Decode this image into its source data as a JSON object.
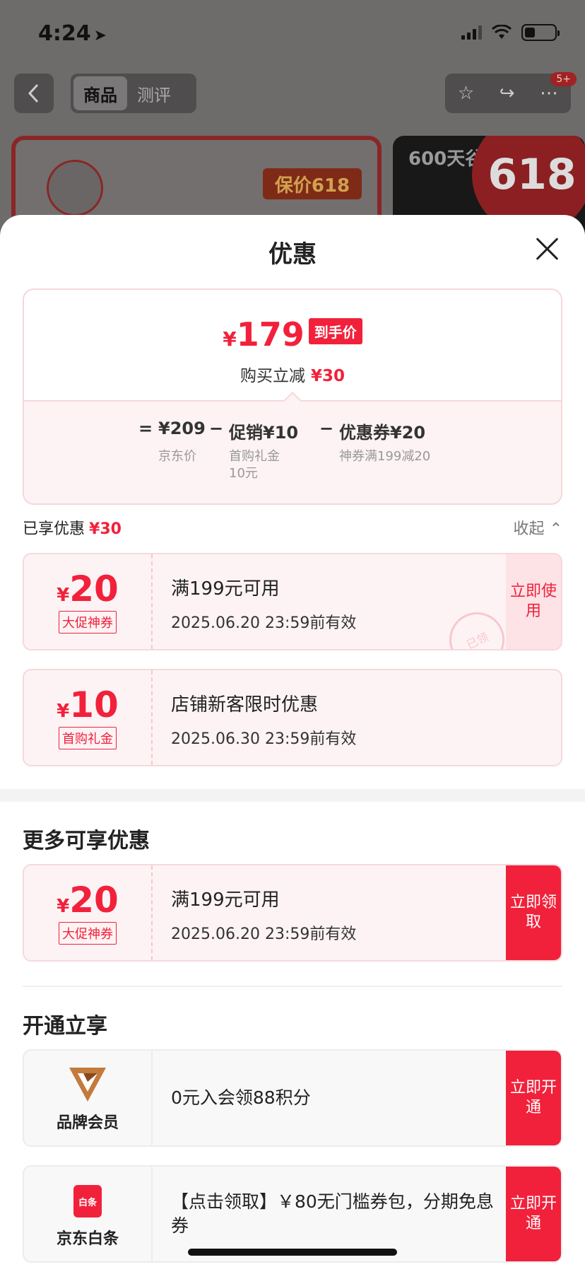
{
  "status_bar": {
    "time": "4:24"
  },
  "nav": {
    "tabs": [
      "商品",
      "测评"
    ],
    "badge": "5+"
  },
  "background": {
    "price_tag": "保价618",
    "promo_text": "600天谷饲",
    "badge_618": "618"
  },
  "sheet": {
    "title": "优惠",
    "price": {
      "currency": "¥",
      "amount": "179",
      "badge": "到手价",
      "sub_label": "购买立减",
      "sub_amount": "¥30"
    },
    "formula": {
      "eq": "=",
      "jd_price": "¥209",
      "jd_price_label": "京东价",
      "minus": "−",
      "promo": "促销¥10",
      "promo_label_1": "首购礼金",
      "promo_label_2": "10元",
      "coupon": "优惠券¥20",
      "coupon_label": "神券满199减20"
    },
    "enjoyed": {
      "label": "已享优惠",
      "amount": "¥30",
      "collapse": "收起"
    },
    "applied_coupons": [
      {
        "currency": "¥",
        "amount": "20",
        "tag": "大促神券",
        "condition": "满199元可用",
        "expiry": "2025.06.20 23:59前有效",
        "action": "立即使用",
        "stamp": "已领"
      },
      {
        "currency": "¥",
        "amount": "10",
        "tag": "首购礼金",
        "condition": "店铺新客限时优惠",
        "expiry": "2025.06.30 23:59前有效"
      }
    ],
    "more_section": {
      "title": "更多可享优惠",
      "coupon": {
        "currency": "¥",
        "amount": "20",
        "tag": "大促神券",
        "condition": "满199元可用",
        "expiry": "2025.06.20 23:59前有效",
        "action": "立即领取"
      }
    },
    "open_section": {
      "title": "开通立享",
      "items": [
        {
          "label": "品牌会员",
          "text": "0元入会领88积分",
          "action": "立即开通"
        },
        {
          "label": "京东白条",
          "logo_text": "白条",
          "text": "【点击领取】￥80无门槛券包，分期免息券",
          "action": "立即开通"
        }
      ]
    }
  },
  "colors": {
    "accent": "#f2213b"
  }
}
